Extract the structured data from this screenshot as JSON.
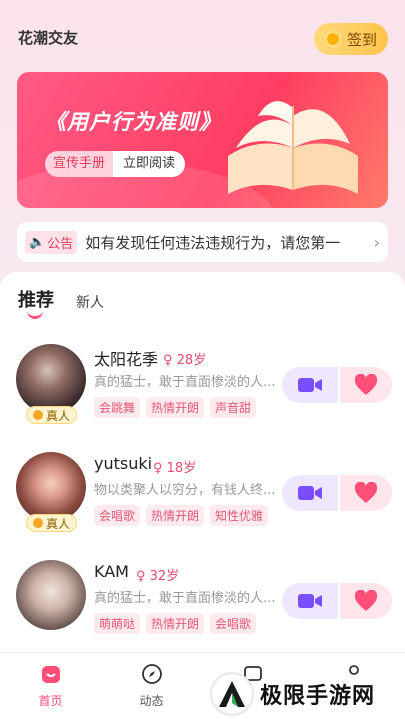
{
  "header": {
    "app_title": "花潮交友",
    "checkin_label": "签到"
  },
  "banner": {
    "title": "《用户行为准则》",
    "pill_left": "宣传手册",
    "pill_right": "立即阅读"
  },
  "notice": {
    "badge": "公告",
    "text": "如有发现任何违法违规行为，请您第一"
  },
  "tabs": {
    "recommend": "推荐",
    "new": "新人"
  },
  "users": [
    {
      "name": "太阳花季",
      "age": "28岁",
      "bio": "真的猛士，敢于直面惨淡的人...",
      "tags": [
        "会跳舞",
        "热情开朗",
        "声音甜"
      ],
      "verified": "真人"
    },
    {
      "name": "yutsuki",
      "age": "18岁",
      "bio": "物以类聚人以穷分，有钱人终...",
      "tags": [
        "会唱歌",
        "热情开朗",
        "知性优雅"
      ],
      "verified": "真人"
    },
    {
      "name": "KAM",
      "age": "32岁",
      "bio": "真的猛士，敢于直面惨淡的人...",
      "tags": [
        "萌萌哒",
        "热情开朗",
        "会唱歌"
      ]
    }
  ],
  "tabbar": {
    "home": "首页",
    "feed": "动态"
  },
  "watermark": {
    "text": "极限手游网"
  },
  "colors": {
    "accent": "#ff4e77",
    "video_purple": "#7b4dff",
    "gold": "#ffc44d"
  }
}
